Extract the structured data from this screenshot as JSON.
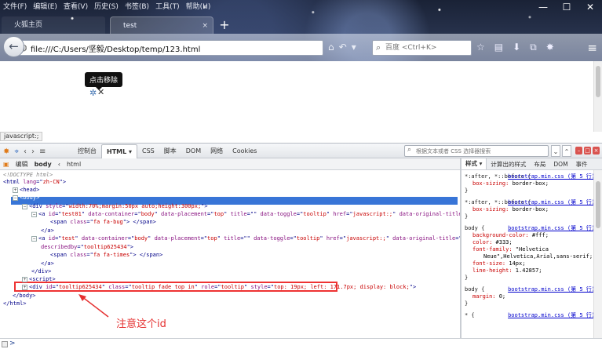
{
  "menubar": [
    "文件(F)",
    "编辑(E)",
    "查看(V)",
    "历史(S)",
    "书签(B)",
    "工具(T)",
    "帮助(H)"
  ],
  "window_controls": {
    "minimize": "—",
    "maximize": "☐",
    "close": "✕"
  },
  "tabs": [
    {
      "label": "火狐主页",
      "close": "×"
    },
    {
      "label": "test",
      "close": "×"
    }
  ],
  "new_tab": "+",
  "urlbar": {
    "url": "file:///C:/Users/坚毅/Desktop/temp/123.html"
  },
  "searchbar": {
    "placeholder": "百度 <Ctrl+K>"
  },
  "page": {
    "tooltip": "点击移除",
    "status_link": "javascript:;"
  },
  "firebug": {
    "tabs": [
      "控制台",
      "HTML ▾",
      "CSS",
      "脚本",
      "DOM",
      "网络",
      "Cookies"
    ],
    "active_tab": "HTML ▾",
    "search_placeholder": "根据文本或者 CSS 选择器搜索",
    "subbar": {
      "edit": "编辑",
      "crumb_body": "body",
      "crumb_html": "html"
    },
    "side_tabs": [
      "样式 ▾",
      "计算出的样式",
      "布局",
      "DOM",
      "事件"
    ],
    "html_lines": [
      {
        "indent": 0,
        "expander": "",
        "html": "<!DOCTYPE html>",
        "kind": "doctype"
      },
      {
        "indent": 0,
        "expander": "",
        "parts": [
          [
            "t-tag",
            "<html "
          ],
          [
            "t-attr",
            "lang"
          ],
          [
            "t-tag",
            "=\""
          ],
          [
            "t-val",
            "zh-CN"
          ],
          [
            "t-tag",
            "\">"
          ]
        ]
      },
      {
        "indent": 1,
        "expander": "+",
        "parts": [
          [
            "t-tag",
            "<head>"
          ]
        ]
      },
      {
        "indent": 1,
        "expander": "−",
        "parts": [
          [
            "sel-text",
            "<body>"
          ]
        ],
        "selected": true
      },
      {
        "indent": 2,
        "expander": "−",
        "parts": [
          [
            "t-tag",
            "<div "
          ],
          [
            "t-attr",
            "style"
          ],
          [
            "t-tag",
            "=\""
          ],
          [
            "t-val",
            "width:70%;margin:50px auto;height:300px;"
          ],
          [
            "t-tag",
            "\">"
          ]
        ]
      },
      {
        "indent": 3,
        "expander": "−",
        "parts": [
          [
            "t-tag",
            "<a "
          ],
          [
            "t-attr",
            "id"
          ],
          [
            "t-tag",
            "=\""
          ],
          [
            "t-val",
            "test01"
          ],
          [
            "t-tag",
            "\" "
          ],
          [
            "t-attr",
            "data-container"
          ],
          [
            "t-tag",
            "=\""
          ],
          [
            "t-val",
            "body"
          ],
          [
            "t-tag",
            "\" "
          ],
          [
            "t-attr",
            "data-placement"
          ],
          [
            "t-tag",
            "=\""
          ],
          [
            "t-val",
            "top"
          ],
          [
            "t-tag",
            "\" "
          ],
          [
            "t-attr",
            "title"
          ],
          [
            "t-tag",
            "=\"\" "
          ],
          [
            "t-attr",
            "data-toggle"
          ],
          [
            "t-tag",
            "=\""
          ],
          [
            "t-val",
            "tooltip"
          ],
          [
            "t-tag",
            "\" "
          ],
          [
            "t-attr",
            "href"
          ],
          [
            "t-tag",
            "=\""
          ],
          [
            "t-val",
            "javascript:;"
          ],
          [
            "t-tag",
            "\" "
          ],
          [
            "t-attr",
            "data-original-title"
          ],
          [
            "t-tag",
            "=\""
          ],
          [
            "t-val",
            "反馈错误"
          ],
          [
            "t-tag",
            "\">"
          ]
        ]
      },
      {
        "indent": 5,
        "expander": "",
        "parts": [
          [
            "t-tag",
            "<span "
          ],
          [
            "t-attr",
            "class"
          ],
          [
            "t-tag",
            "=\""
          ],
          [
            "t-val",
            "fa fa-bug"
          ],
          [
            "t-tag",
            "\"> </span>"
          ]
        ]
      },
      {
        "indent": 4,
        "expander": "",
        "parts": [
          [
            "t-tag",
            "</a>"
          ]
        ]
      },
      {
        "indent": 3,
        "expander": "−",
        "parts": [
          [
            "t-tag",
            "<a "
          ],
          [
            "t-attr",
            "id"
          ],
          [
            "t-tag",
            "=\""
          ],
          [
            "t-val",
            "test"
          ],
          [
            "t-tag",
            "\" "
          ],
          [
            "t-attr",
            "data-container"
          ],
          [
            "t-tag",
            "=\""
          ],
          [
            "t-val",
            "body"
          ],
          [
            "t-tag",
            "\" "
          ],
          [
            "t-attr",
            "data-placement"
          ],
          [
            "t-tag",
            "=\""
          ],
          [
            "t-val",
            "top"
          ],
          [
            "t-tag",
            "\" "
          ],
          [
            "t-attr",
            "title"
          ],
          [
            "t-tag",
            "=\"\" "
          ],
          [
            "t-attr",
            "data-toggle"
          ],
          [
            "t-tag",
            "=\""
          ],
          [
            "t-val",
            "tooltip"
          ],
          [
            "t-tag",
            "\" "
          ],
          [
            "t-attr",
            "href"
          ],
          [
            "t-tag",
            "=\""
          ],
          [
            "t-val",
            "javascript:;"
          ],
          [
            "t-tag",
            "\" "
          ],
          [
            "t-attr",
            "data-original-title"
          ],
          [
            "t-tag",
            "=\""
          ],
          [
            "t-val",
            "点击移除"
          ],
          [
            "t-tag",
            "\" aria-"
          ]
        ]
      },
      {
        "indent": 4,
        "expander": "",
        "parts": [
          [
            "t-attr",
            "describedby"
          ],
          [
            "t-tag",
            "=\""
          ],
          [
            "t-val",
            "tooltip625434"
          ],
          [
            "t-tag",
            "\">"
          ]
        ]
      },
      {
        "indent": 5,
        "expander": "",
        "parts": [
          [
            "t-tag",
            "<span "
          ],
          [
            "t-attr",
            "class"
          ],
          [
            "t-tag",
            "=\""
          ],
          [
            "t-val",
            "fa fa-times"
          ],
          [
            "t-tag",
            "\"> </span>"
          ]
        ]
      },
      {
        "indent": 4,
        "expander": "",
        "parts": [
          [
            "t-tag",
            "</a>"
          ]
        ]
      },
      {
        "indent": 3,
        "expander": "",
        "parts": [
          [
            "t-tag",
            "</div>"
          ]
        ]
      },
      {
        "indent": 2,
        "expander": "+",
        "parts": [
          [
            "t-tag",
            "<script>"
          ]
        ]
      },
      {
        "indent": 2,
        "expander": "+",
        "parts": [
          [
            "t-tag",
            "<div "
          ],
          [
            "t-attr",
            "id"
          ],
          [
            "t-tag",
            "=\""
          ],
          [
            "t-val",
            "tooltip625434"
          ],
          [
            "t-tag",
            "\" "
          ],
          [
            "t-attr",
            "class"
          ],
          [
            "t-tag",
            "=\""
          ],
          [
            "t-val",
            "tooltip fade top in"
          ],
          [
            "t-tag",
            "\" "
          ],
          [
            "t-attr",
            "role"
          ],
          [
            "t-tag",
            "=\""
          ],
          [
            "t-val",
            "tooltip"
          ],
          [
            "t-tag",
            "\" "
          ],
          [
            "t-attr",
            "style"
          ],
          [
            "t-tag",
            "=\""
          ],
          [
            "t-val",
            "top: 19px; left: 171.7px; display: block;"
          ],
          [
            "t-tag",
            "\">"
          ]
        ]
      },
      {
        "indent": 1,
        "expander": "",
        "parts": [
          [
            "t-tag",
            "</body>"
          ]
        ]
      },
      {
        "indent": 0,
        "expander": "",
        "parts": [
          [
            "t-tag",
            "</html>"
          ]
        ]
      }
    ],
    "css_rules": [
      {
        "selector": "*:after, *::before {",
        "source": "bootstrap.min.css (第 5 行)",
        "props": [
          [
            "box-sizing",
            "border-box;"
          ]
        ]
      },
      {
        "selector": "*:after, *::before {",
        "source": "bootstrap.min.css (第 5 行)",
        "props": [
          [
            "box-sizing",
            "border-box;"
          ]
        ]
      },
      {
        "selector": "body {",
        "source": "bootstrap.min.css (第 5 行)",
        "props": [
          [
            "background-color",
            "#fff;"
          ],
          [
            "color",
            "#333;"
          ],
          [
            "font-family",
            "\"Helvetica"
          ],
          [
            "",
            "Neue\",Helvetica,Arial,sans-serif;"
          ],
          [
            "font-size",
            "14px;"
          ],
          [
            "line-height",
            "1.42857;"
          ]
        ]
      },
      {
        "selector": "body {",
        "source": "bootstrap.min.css (第 5 行)",
        "props": [
          [
            "margin",
            "0;"
          ]
        ]
      },
      {
        "selector": "* {",
        "source": "bootstrap.min.css (第 5 行)",
        "props": []
      }
    ],
    "cmd_prompt": ">"
  },
  "annotation": {
    "text": "注意这个id",
    "color": "#e53030"
  }
}
